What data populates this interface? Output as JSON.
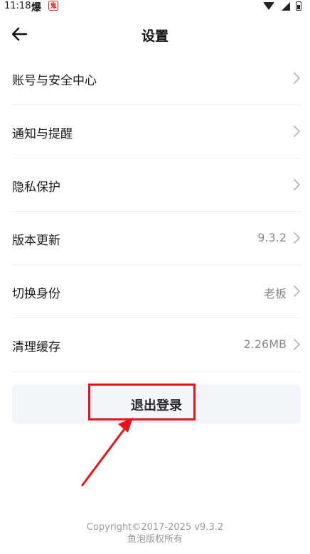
{
  "status_bar": {
    "time": "11:18",
    "icon_left_1": "爆",
    "icon_left_2": "鬼"
  },
  "header": {
    "back_icon": "back-arrow-icon",
    "title": "设置"
  },
  "settings": {
    "items": [
      {
        "label": "账号与安全中心",
        "value": ""
      },
      {
        "label": "通知与提醒",
        "value": ""
      },
      {
        "label": "隐私保护",
        "value": ""
      },
      {
        "label": "版本更新",
        "value": "9.3.2"
      },
      {
        "label": "切换身份",
        "value": "老板"
      },
      {
        "label": "清理缓存",
        "value": "2.26MB"
      }
    ]
  },
  "logout": {
    "label": "退出登录"
  },
  "footer": {
    "copyright": "Copyright©2017-2025 v9.3.2",
    "rights": "鱼泡版权所有"
  },
  "colors": {
    "annotation": "#e8141c",
    "logout_bg": "#f4f5f9"
  }
}
